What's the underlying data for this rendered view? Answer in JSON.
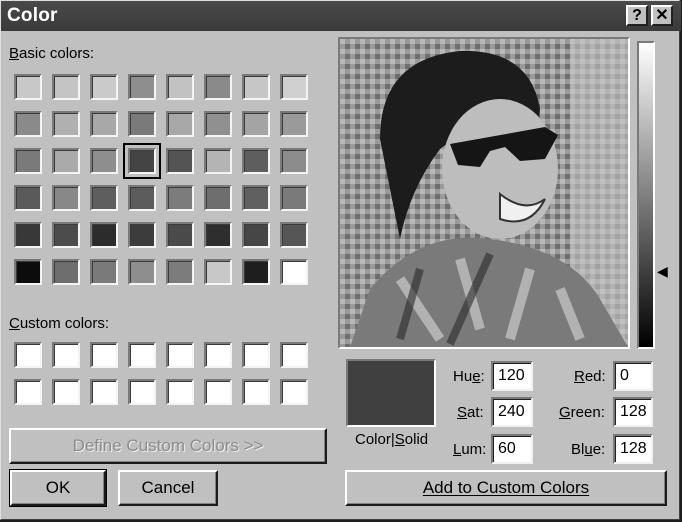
{
  "window": {
    "title": "Color",
    "help_glyph": "?",
    "close_glyph": "✕"
  },
  "basic_colors": {
    "label_underlined": "B",
    "label_rest": "asic colors:",
    "rows": [
      [
        "#c8c8c8",
        "#c4c4c4",
        "#cacaca",
        "#8e8e8e",
        "#c2c2c2",
        "#8a8a8a",
        "#c6c6c6",
        "#d0d0d0"
      ],
      [
        "#8a8a8a",
        "#b0b0b0",
        "#a8a8a8",
        "#7a7a7a",
        "#a8a8a8",
        "#909090",
        "#a4a4a4",
        "#9a9a9a"
      ],
      [
        "#7a7a7a",
        "#aaaaaa",
        "#8e8e8e",
        "#444444",
        "#545454",
        "#b4b4b4",
        "#5e5e5e",
        "#8c8c8c"
      ],
      [
        "#5a5a5a",
        "#888888",
        "#5e5e5e",
        "#5c5c5c",
        "#7c7c7c",
        "#6e6e6e",
        "#606060",
        "#7a7a7a"
      ],
      [
        "#383838",
        "#4c4c4c",
        "#2c2c2c",
        "#3c3c3c",
        "#4a4a4a",
        "#2e2e2e",
        "#464646",
        "#565656"
      ],
      [
        "#0c0c0c",
        "#6e6e6e",
        "#7a7a7a",
        "#8e8e8e",
        "#7c7c7c",
        "#c8c8c8",
        "#1e1e1e",
        "#ffffff"
      ]
    ],
    "selected_row": 2,
    "selected_col": 3
  },
  "custom_colors": {
    "label_underlined": "C",
    "label_rest": "ustom colors:",
    "swatch": "#ffffff"
  },
  "buttons": {
    "define_custom": "Define Custom Colors >>",
    "ok": "OK",
    "cancel": "Cancel",
    "add_custom": "Add to Custom Colors"
  },
  "preview": {
    "color": "#404040",
    "label_left": "Color|",
    "label_underlined": "S",
    "label_right": "olid"
  },
  "fields": {
    "hue": {
      "pre": "Hu",
      "u": "e",
      "post": ":",
      "value": "120"
    },
    "sat": {
      "pre": "",
      "u": "S",
      "post": "at:",
      "value": "240"
    },
    "lum": {
      "pre": "",
      "u": "L",
      "post": "um:",
      "value": "60"
    },
    "red": {
      "pre": "",
      "u": "R",
      "post": "ed:",
      "value": "0"
    },
    "green": {
      "pre": "",
      "u": "G",
      "post": "reen:",
      "value": "128"
    },
    "blue": {
      "pre": "Bl",
      "u": "u",
      "post": "e:",
      "value": "128"
    }
  },
  "luminance": {
    "marker_glyph": "◀",
    "level": 0.25
  }
}
